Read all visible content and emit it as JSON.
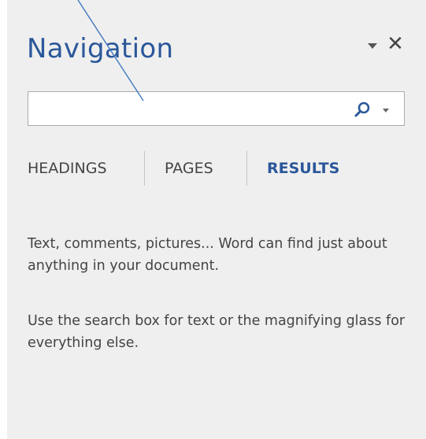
{
  "pane": {
    "title": "Navigation",
    "options_icon": "chevron-down-icon",
    "close_icon": "close-icon",
    "close_glyph": "✕"
  },
  "search": {
    "value": "",
    "placeholder": "",
    "search_icon": "magnifying-glass-icon",
    "dropdown_icon": "chevron-down-icon"
  },
  "tabs": [
    {
      "label": "HEADINGS",
      "active": false
    },
    {
      "label": "PAGES",
      "active": false
    },
    {
      "label": "RESULTS",
      "active": true
    }
  ],
  "results": {
    "message_1": "Text, comments, pictures... Word can find just about anything in your document.",
    "message_2": "Use the search box for text or the magnifying glass for everything else."
  },
  "colors": {
    "accent": "#2b579a",
    "pane_background": "#efefef",
    "text": "#444444",
    "annotation_line": "#4a7fc1"
  }
}
